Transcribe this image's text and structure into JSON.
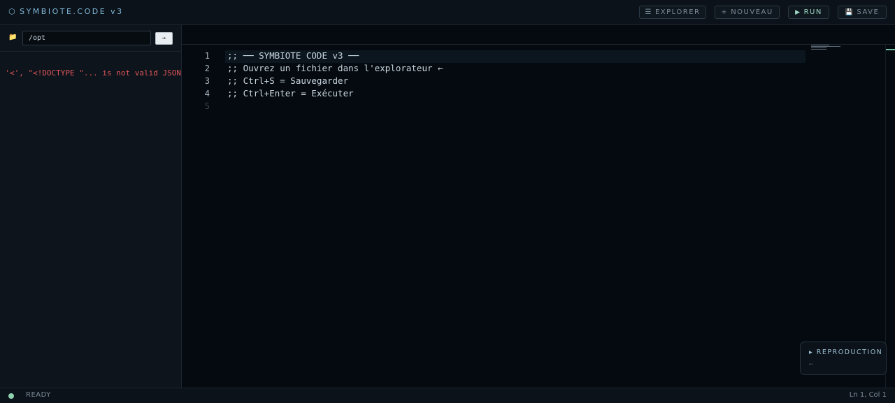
{
  "app": {
    "hex_icon": "⬡",
    "title": "SYMBIOTE.CODE v3"
  },
  "toolbar": {
    "explorer": {
      "icon": "☰",
      "label": "EXPLORER"
    },
    "nouveau": {
      "icon": "+",
      "label": "NOUVEAU"
    },
    "run": {
      "icon": "▶",
      "label": "RUN"
    },
    "save": {
      "icon": "💾",
      "label": "SAVE"
    }
  },
  "sidebar": {
    "folder_icon": "📁",
    "path_value": "/opt",
    "go_label": "→",
    "error": "Unexpected token '<', \"<!DOCTYPE \"... is not valid JSON"
  },
  "editor": {
    "lines": [
      {
        "num": "1",
        "text": ";; ── SYMBIOTE CODE v3 ──"
      },
      {
        "num": "2",
        "text": ";; Ouvrez un fichier dans l'explorateur ←"
      },
      {
        "num": "3",
        "text": ";; Ctrl+S = Sauvegarder"
      },
      {
        "num": "4",
        "text": ";; Ctrl+Enter = Exécuter"
      },
      {
        "num": "5",
        "text": ""
      }
    ]
  },
  "repro": {
    "title": "▸ REPRODUCTION",
    "subtitle": "…"
  },
  "status": {
    "state": "READY",
    "cursor": "Ln 1, Col 1"
  },
  "colors": {
    "accent": "#7fb6d6",
    "error": "#e0565b",
    "ready": "#8fd2b0"
  }
}
